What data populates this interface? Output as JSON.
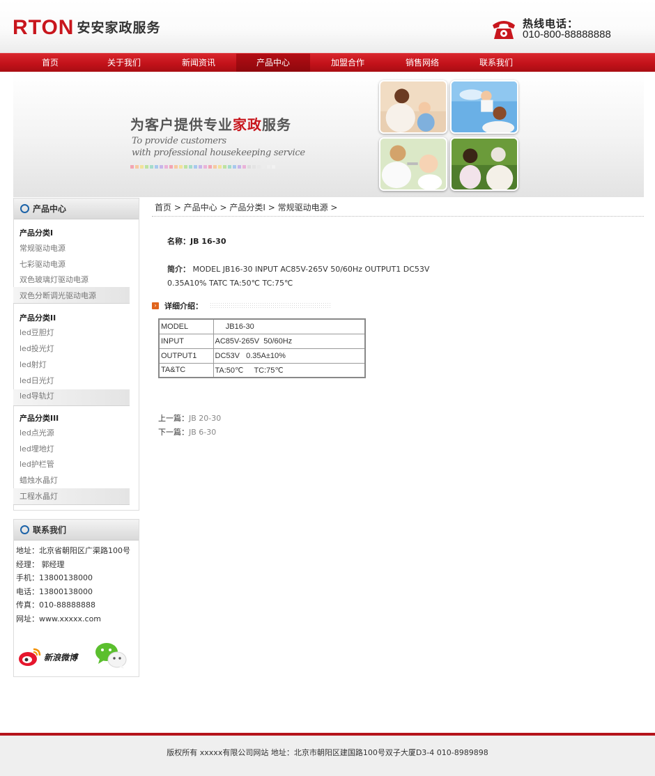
{
  "header": {
    "logo_en": "RTON",
    "logo_cn": "安安家政服务",
    "hotline_label": "热线电话：",
    "hotline_number": "010-800-88888888"
  },
  "nav": {
    "items": [
      {
        "label": "首页"
      },
      {
        "label": "关于我们"
      },
      {
        "label": "新闻资讯"
      },
      {
        "label": "产品中心",
        "active": true
      },
      {
        "label": "加盟合作"
      },
      {
        "label": "销售网络"
      },
      {
        "label": "联系我们"
      }
    ]
  },
  "banner": {
    "title_a": "为客户提供专业",
    "title_hl": "家政",
    "title_b": "服务",
    "sub1": "To provide customers",
    "sub2": "with professional housekeeping service"
  },
  "sidebar": {
    "products_title": "产品中心",
    "categories": [
      {
        "title": "产品分类I",
        "items": [
          "常规驱动电源",
          "七彩驱动电源",
          "双色玻璃灯驱动电源",
          "双色分断调光驱动电源"
        ]
      },
      {
        "title": "产品分类II",
        "items": [
          "led豆胆灯",
          "led投光灯",
          "led射灯",
          "led日光灯",
          "led导轨灯"
        ]
      },
      {
        "title": "产品分类III",
        "items": [
          "led点光源",
          "led埋地灯",
          "led护栏管",
          "蜡烛水晶灯",
          "工程水晶灯"
        ]
      }
    ],
    "contact_title": "联系我们",
    "contact": [
      "地址：北京省朝阳区广渠路100号",
      "经理： 郭经理",
      "手机：13800138000",
      "电话：13800138000",
      "传真：010-88888888",
      "网址：www.xxxxx.com"
    ],
    "weibo_label": "新浪微博"
  },
  "main": {
    "breadcrumb": "首页 > 产品中心 > 产品分类I > 常规驱动电源 >",
    "name_label": "名称：",
    "name_value": "JB 16-30",
    "desc_label": "简介：",
    "desc_value": " MODEL JB16-30 INPUT AC85V-265V 50/60Hz OUTPUT1 DC53V 0.35A10% TATC TA:50℃ TC:75℃",
    "detail_label": "详细介绍：",
    "spec_rows": [
      [
        "MODEL",
        "     JB16-30"
      ],
      [
        "INPUT",
        "AC85V-265V  50/60Hz"
      ],
      [
        "OUTPUT1",
        "DC53V   0.35A±10%"
      ],
      [
        "TA&TC",
        "TA:50℃     TC:75℃"
      ]
    ],
    "prev_label": "上一篇：",
    "prev_link": "JB 20-30",
    "next_label": "下一篇：",
    "next_link": "JB 6-30"
  },
  "footer": {
    "text": "版权所有 xxxxx有限公司网站 地址：北京市朝阳区建国路100号双子大厦D3-4 010-8989898"
  },
  "colors": {
    "brand_red": "#c8161d",
    "nav_red": "#c3121a",
    "accent_blue": "#1c63a8",
    "detail_orange": "#e0641c"
  }
}
